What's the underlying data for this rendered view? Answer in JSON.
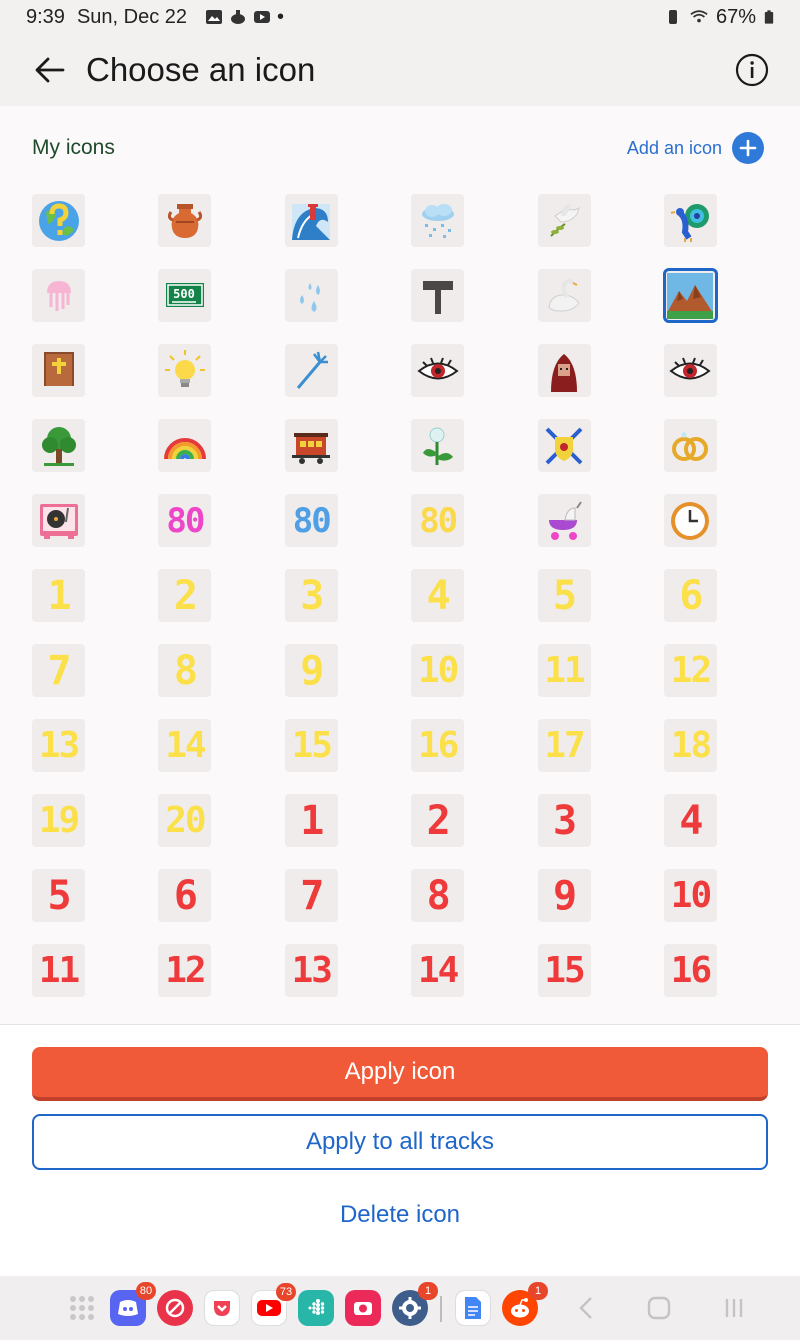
{
  "status_bar": {
    "time": "9:39",
    "date": "Sun, Dec 22",
    "dot": "•",
    "battery": "67%"
  },
  "header": {
    "title": "Choose an icon"
  },
  "section": {
    "title": "My icons",
    "add_label": "Add an icon"
  },
  "icons_picture_row": [
    [
      "globe-question-icon",
      "vase-icon",
      "tsunami-icon",
      "snow-cloud-icon",
      "dove-olive-icon",
      "peacock-icon"
    ],
    [
      "jellyfish-icon",
      "sign-500-icon",
      "water-drops-icon",
      "hammer-icon",
      "swan-icon",
      "mountain-landscape-icon"
    ],
    [
      "bible-icon",
      "light-bulb-icon",
      "trident-icon",
      "eye-icon",
      "hooded-figure-icon",
      "eye-icon"
    ],
    [
      "tree-icon",
      "rainbow-icon",
      "train-car-icon",
      "flower-icon",
      "crossed-swords-shield-icon",
      "rings-icon"
    ],
    [
      "record-player-icon",
      "80",
      "80",
      "80",
      "stroller-icon",
      "clock-icon"
    ]
  ],
  "row5_colors": [
    "",
    "pink",
    "blue",
    "gold",
    "",
    ""
  ],
  "number_tiles": [
    [
      "1",
      "2",
      "3",
      "4",
      "5",
      "6"
    ],
    [
      "7",
      "8",
      "9",
      "10",
      "11",
      "12"
    ],
    [
      "13",
      "14",
      "15",
      "16",
      "17",
      "18"
    ],
    [
      "19",
      "20",
      "1",
      "2",
      "3",
      "4"
    ],
    [
      "5",
      "6",
      "7",
      "8",
      "9",
      "10"
    ],
    [
      "11",
      "12",
      "13",
      "14",
      "15",
      "16"
    ]
  ],
  "number_colors": [
    [
      "yellow",
      "yellow",
      "yellow",
      "yellow",
      "yellow",
      "yellow"
    ],
    [
      "yellow",
      "yellow",
      "yellow",
      "yellow",
      "yellow",
      "yellow"
    ],
    [
      "yellow",
      "yellow",
      "yellow",
      "yellow",
      "yellow",
      "yellow"
    ],
    [
      "yellow",
      "yellow",
      "red",
      "red",
      "red",
      "red"
    ],
    [
      "red",
      "red",
      "red",
      "red",
      "red",
      "red"
    ],
    [
      "red",
      "red",
      "red",
      "red",
      "red",
      "red"
    ]
  ],
  "selected_icon": "mountain-landscape-icon",
  "actions": {
    "apply": "Apply icon",
    "apply_all": "Apply to all tracks",
    "delete": "Delete icon"
  },
  "nav_badges": {
    "discord": "80",
    "youtube": "73",
    "settings": "1",
    "reddit": "1"
  },
  "colors": {
    "accent_blue": "#1f66c9",
    "apply_orange": "#f15a38",
    "section_green": "#1f4a2c"
  }
}
